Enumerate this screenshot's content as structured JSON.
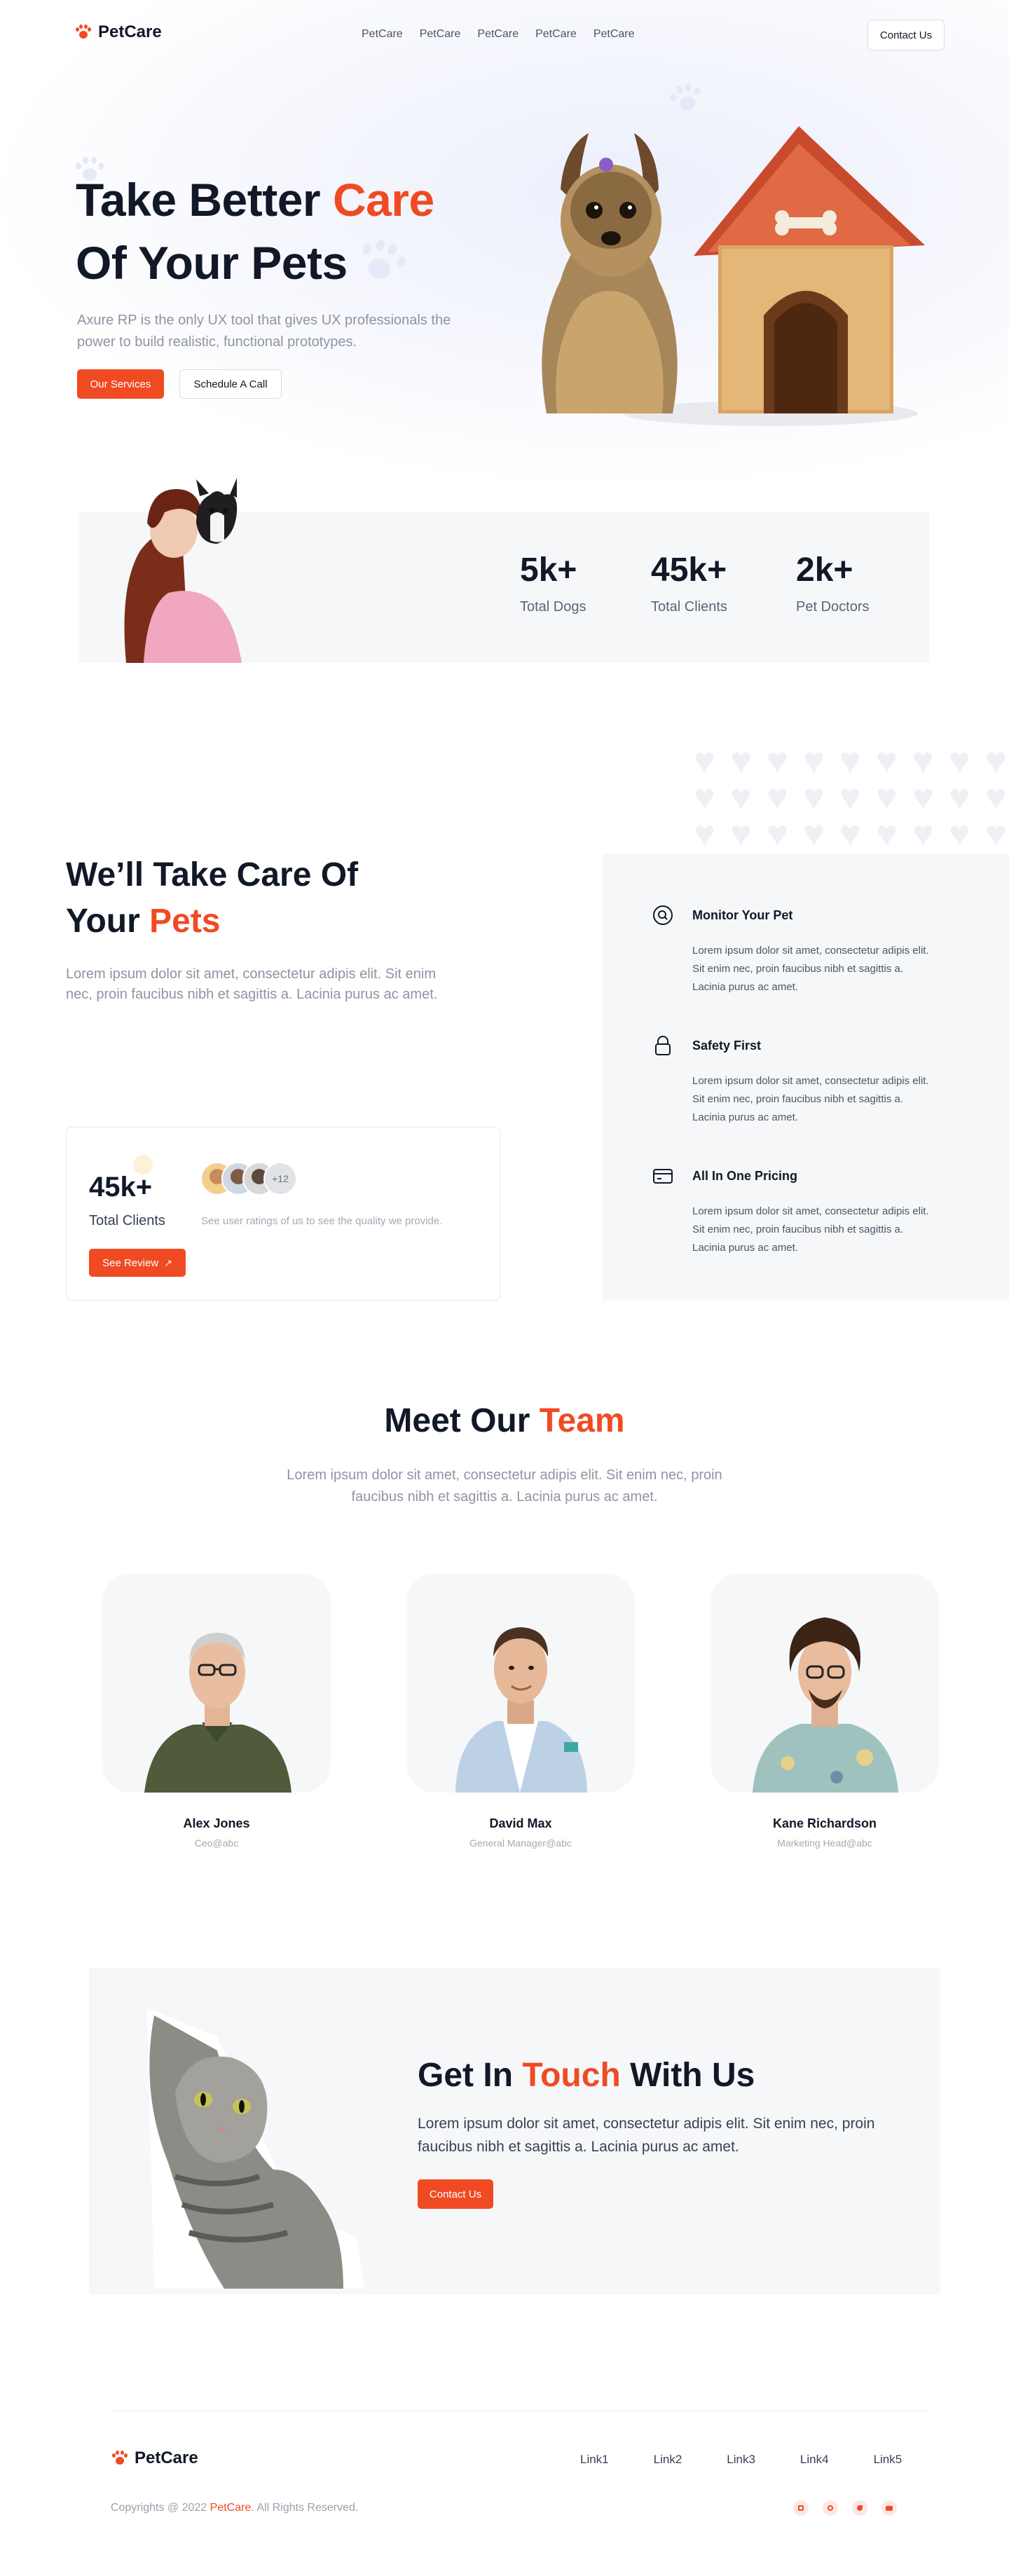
{
  "nav": {
    "brand": "PetCare",
    "links": [
      "PetCare",
      "PetCare",
      "PetCare",
      "PetCare",
      "PetCare"
    ],
    "contact_label": "Contact Us"
  },
  "hero": {
    "title_part1": "Take Better ",
    "title_accent": "Care",
    "title_line2": "Of Your Pets",
    "subtitle": "Axure RP is the only UX tool that gives UX professionals the power to build realistic, functional prototypes.",
    "primary_label": "Our Services",
    "secondary_label": "Schedule A Call"
  },
  "stats": [
    {
      "value": "5k+",
      "label": "Total Dogs"
    },
    {
      "value": "45k+",
      "label": "Total Clients"
    },
    {
      "value": "2k+",
      "label": "Pet Doctors"
    }
  ],
  "care": {
    "title_line1": "We’ll Take Care Of",
    "title_line2_plain": "Your ",
    "title_line2_accent": "Pets",
    "subtitle": "Lorem ipsum dolor sit amet, consectetur adipis elit. Sit enim nec, proin faucibus nibh et sagittis a. Lacinia purus ac amet.",
    "review": {
      "value": "45k+",
      "label": "Total Clients",
      "avatar_more": "+12",
      "note": "See user ratings of us to see the quality we provide.",
      "button_label": "See Review"
    },
    "features": [
      {
        "icon": "search-icon",
        "title": "Monitor Your Pet",
        "text": "Lorem ipsum dolor sit amet, consectetur adipis elit. Sit enim nec, proin faucibus nibh et sagittis a. Lacinia purus ac amet."
      },
      {
        "icon": "lock-icon",
        "title": "Safety First",
        "text": "Lorem ipsum dolor sit amet, consectetur adipis elit. Sit enim nec, proin faucibus nibh et sagittis a. Lacinia purus ac amet."
      },
      {
        "icon": "card-icon",
        "title": "All In One Pricing",
        "text": "Lorem ipsum dolor sit amet, consectetur adipis elit. Sit enim nec, proin faucibus nibh et sagittis a. Lacinia purus ac amet."
      }
    ]
  },
  "team": {
    "title_plain": "Meet Our ",
    "title_accent": "Team",
    "subtitle": "Lorem ipsum dolor sit amet, consectetur adipis elit. Sit enim nec, proin faucibus nibh et sagittis a. Lacinia purus ac amet.",
    "members": [
      {
        "name": "Alex Jones",
        "role": "Ceo@abc"
      },
      {
        "name": "David Max",
        "role": "General Manager@abc"
      },
      {
        "name": "Kane Richardson",
        "role": "Marketing Head@abc"
      }
    ]
  },
  "contact": {
    "title_plain1": "Get In ",
    "title_accent": "Touch",
    "title_plain2": " With Us",
    "subtitle": "Lorem ipsum dolor sit amet, consectetur adipis elit. Sit enim nec, proin faucibus nibh et sagittis a. Lacinia purus ac amet.",
    "button_label": "Contact Us"
  },
  "footer": {
    "brand": "PetCare",
    "links": [
      "Link1",
      "Link2",
      "Link3",
      "Link4",
      "Link5"
    ],
    "copyright_before": "Copyrights @ 2022 ",
    "copyright_brand": "PetCare",
    "copyright_after": ". All Rights Reserved.",
    "social": [
      "instagram-icon",
      "dribbble-icon",
      "twitter-icon",
      "youtube-icon"
    ]
  },
  "colors": {
    "accent": "#f04a23",
    "heading": "#111827",
    "muted": "#8e94a4",
    "panel": "#f6f7f9"
  }
}
